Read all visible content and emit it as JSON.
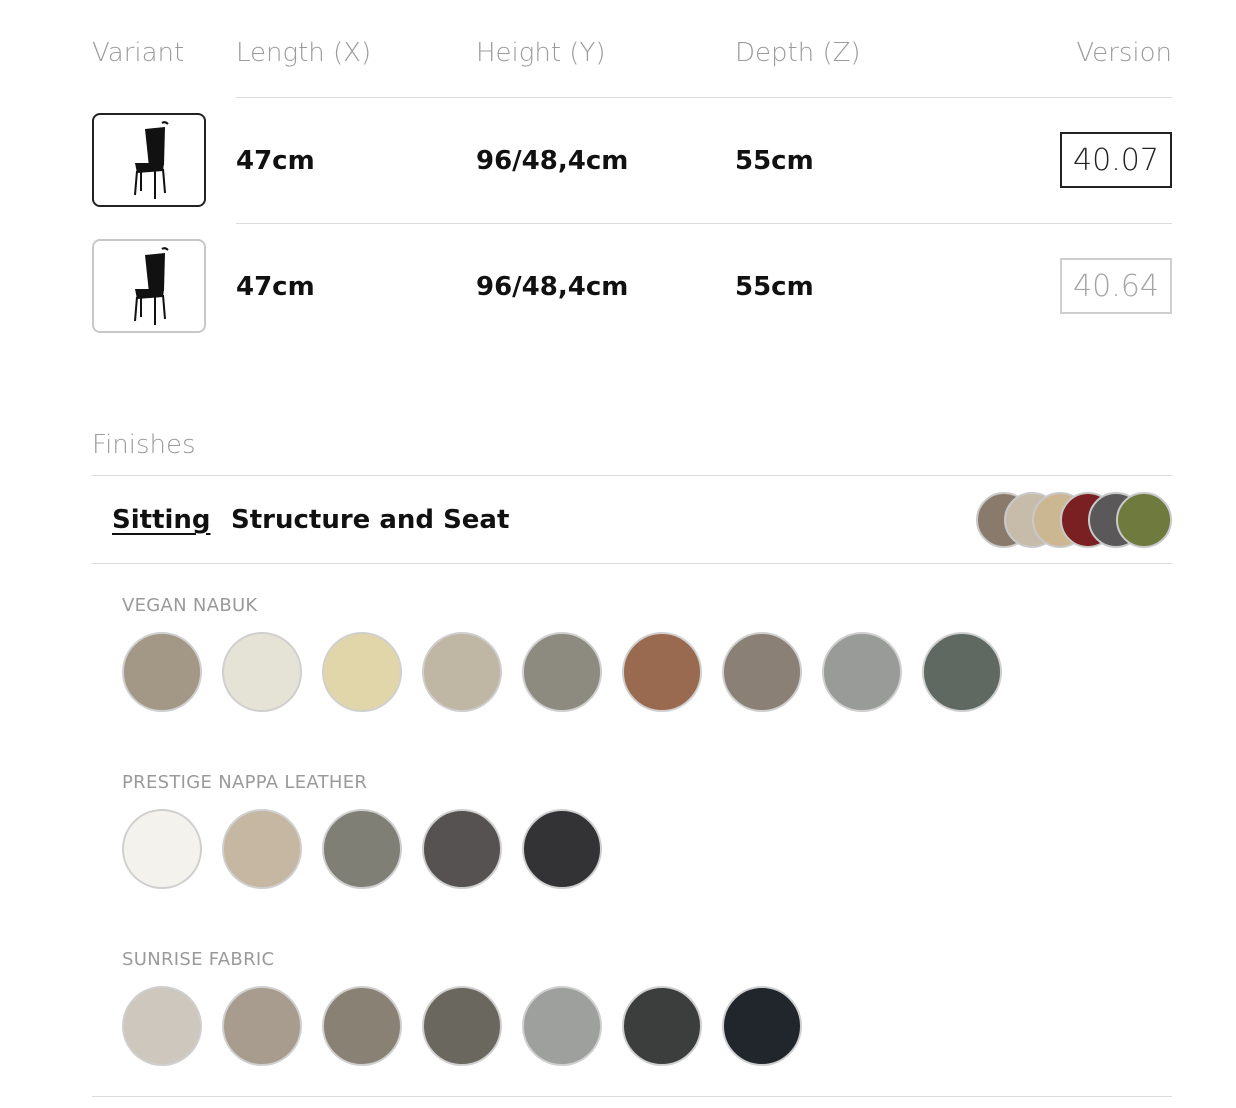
{
  "table": {
    "headers": {
      "variant": "Variant",
      "length": "Length (X)",
      "height": "Height (Y)",
      "depth": "Depth (Z)",
      "version": "Version"
    },
    "rows": [
      {
        "length": "47cm",
        "height": "96/48,4cm",
        "depth": "55cm",
        "version": "40.07",
        "selected": true
      },
      {
        "length": "47cm",
        "height": "96/48,4cm",
        "depth": "55cm",
        "version": "40.64",
        "selected": false
      }
    ]
  },
  "finishes": {
    "title": "Finishes",
    "tabs": {
      "sitting": "Sitting",
      "structure": "Structure and Seat"
    },
    "preview_colors": [
      "#8a7a6c",
      "#c7bca9",
      "#cbb892",
      "#7a1f22",
      "#5a5859",
      "#6e7a3e"
    ],
    "groups": [
      {
        "label": "VEGAN NABUK",
        "colors": [
          "#a39786",
          "#e4e3d6",
          "#e1d6a9",
          "#bfb6a4",
          "#8d8a80",
          "#9a6a50",
          "#8a8075",
          "#999b98",
          "#5f6962"
        ]
      },
      {
        "label": "PRESTIGE NAPPA LEATHER",
        "colors": [
          "#f4f2ec",
          "#c6b7a2",
          "#7f7f76",
          "#565252",
          "#333234"
        ]
      },
      {
        "label": "SUNRISE FABRIC",
        "colors": [
          "#cdc7bd",
          "#a89c8e",
          "#8a8175",
          "#6a675e",
          "#9ea09d",
          "#3c3d3d",
          "#21262c"
        ]
      }
    ]
  }
}
